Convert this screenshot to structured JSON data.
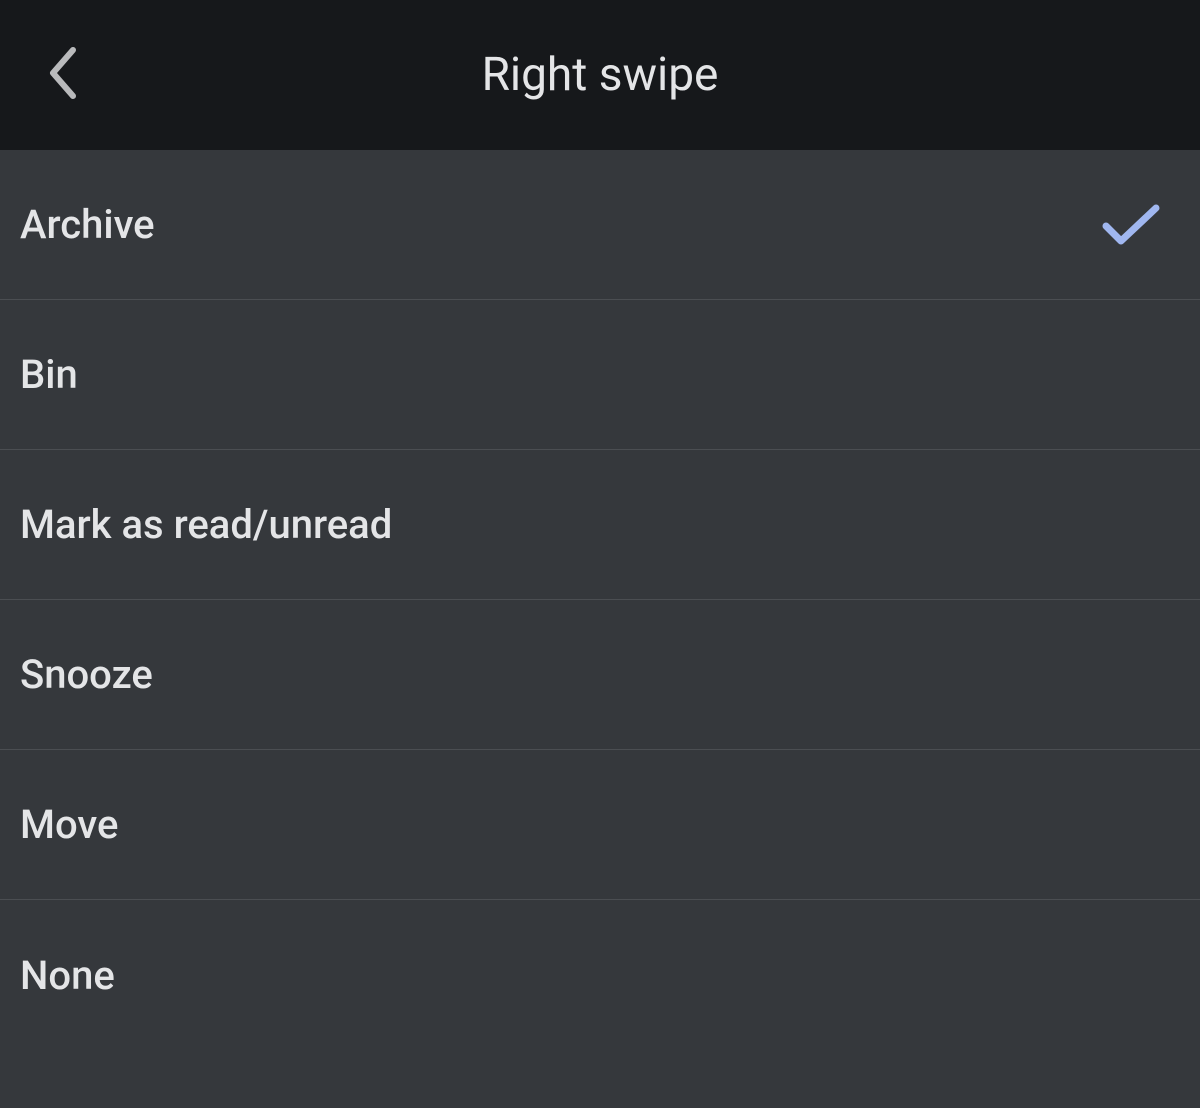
{
  "header": {
    "title": "Right swipe"
  },
  "options": [
    {
      "label": "Archive",
      "selected": true
    },
    {
      "label": "Bin",
      "selected": false
    },
    {
      "label": "Mark as read/unread",
      "selected": false
    },
    {
      "label": "Snooze",
      "selected": false
    },
    {
      "label": "Move",
      "selected": false
    },
    {
      "label": "None",
      "selected": false
    }
  ],
  "colors": {
    "accent": "#a0b7f0",
    "header_bg": "#16181b",
    "list_bg": "#35383c",
    "text": "#e4e5e7",
    "divider": "#4b4e52"
  }
}
